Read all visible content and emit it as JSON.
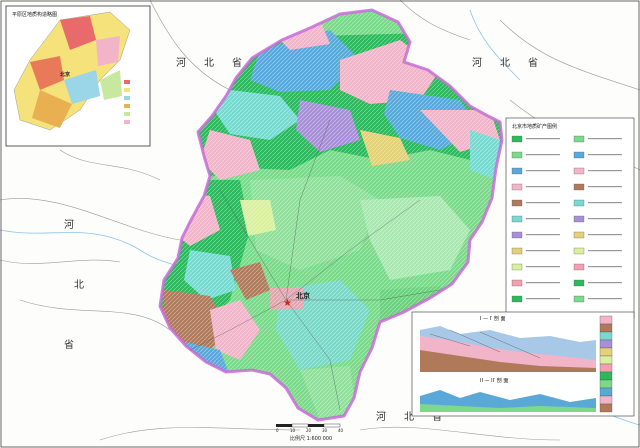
{
  "map": {
    "capital_label": "北京",
    "province_labels": [
      "河",
      "北",
      "省",
      "河",
      "北",
      "省",
      "河",
      "北",
      "省",
      "河",
      "北",
      "省"
    ],
    "inset_map": {
      "title": "平原区地质构造略图",
      "label": "北京"
    },
    "legend": {
      "title": "北京市地质矿产图例"
    },
    "section_1": {
      "title": "I — I′ 剖 面"
    },
    "section_2": {
      "title": "II — II′ 剖 面"
    },
    "scale_bar": {
      "text": "比例尺 1:600 000",
      "ticks": [
        "0",
        "10",
        "20",
        "30",
        "40"
      ]
    },
    "colors": {
      "plain_green": "#7dd88a",
      "mountain_green": "#2eb85c",
      "pink": "#f2b4c8",
      "blue": "#5aa8d8",
      "brown": "#b07a5a",
      "cyan": "#79d9d0",
      "purple": "#a890d8",
      "boundary": "#c86cd8"
    }
  }
}
